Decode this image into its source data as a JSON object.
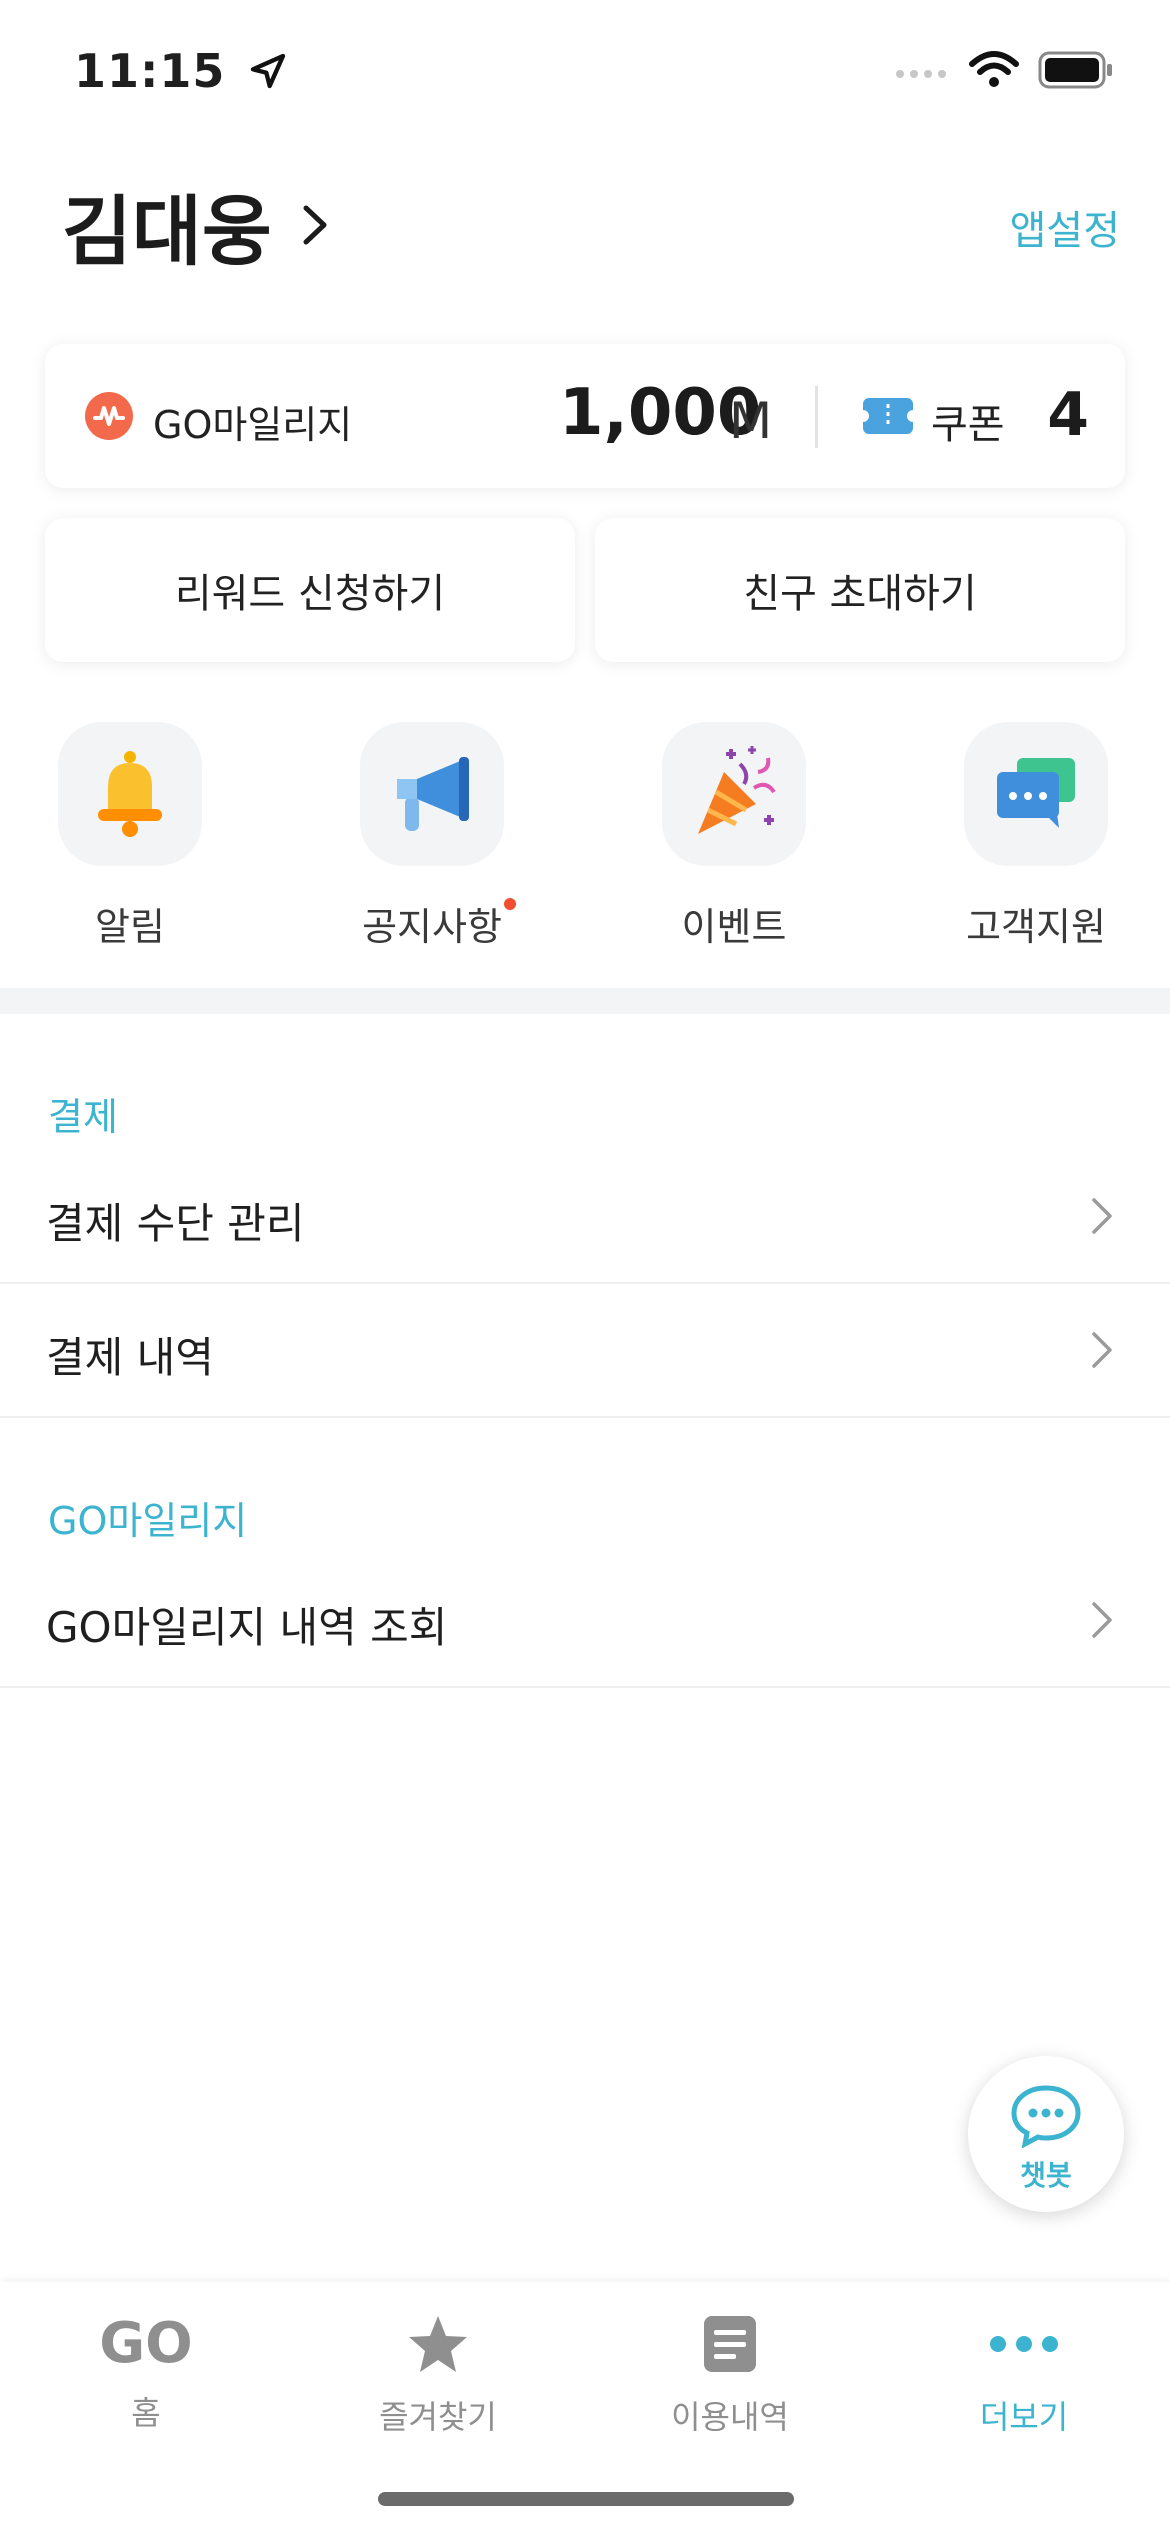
{
  "status_bar": {
    "time": "11:15"
  },
  "header": {
    "user_name": "김대웅",
    "app_settings": "앱설정"
  },
  "mileage_card": {
    "label": "GO마일리지",
    "value": "1,000",
    "unit": "M",
    "coupon_label": "쿠폰",
    "coupon_count": "4"
  },
  "actions": {
    "reward": "리워드 신청하기",
    "invite": "친구 초대하기"
  },
  "quick_menu": [
    {
      "label": "알림",
      "icon": "bell-icon"
    },
    {
      "label": "공지사항",
      "icon": "megaphone-icon",
      "has_dot": true
    },
    {
      "label": "이벤트",
      "icon": "party-popper-icon"
    },
    {
      "label": "고객지원",
      "icon": "chat-bubbles-icon"
    }
  ],
  "sections": {
    "payment": {
      "title": "결제",
      "items": [
        "결제 수단 관리",
        "결제 내역"
      ]
    },
    "mileage": {
      "title": "GO마일리지",
      "items": [
        "GO마일리지 내역 조회"
      ]
    }
  },
  "chatbot": {
    "label": "챗봇"
  },
  "tabbar": [
    {
      "label": "홈",
      "icon_text": "GO",
      "active": false
    },
    {
      "label": "즐겨찾기",
      "icon": "star-icon",
      "active": false
    },
    {
      "label": "이용내역",
      "icon": "document-icon",
      "active": false
    },
    {
      "label": "더보기",
      "icon": "more-dots-icon",
      "active": true
    }
  ],
  "colors": {
    "accent": "#3db4cf",
    "mileage": "#f26a4b",
    "coupon": "#4aa3df",
    "notice_dot": "#f04e2e"
  }
}
